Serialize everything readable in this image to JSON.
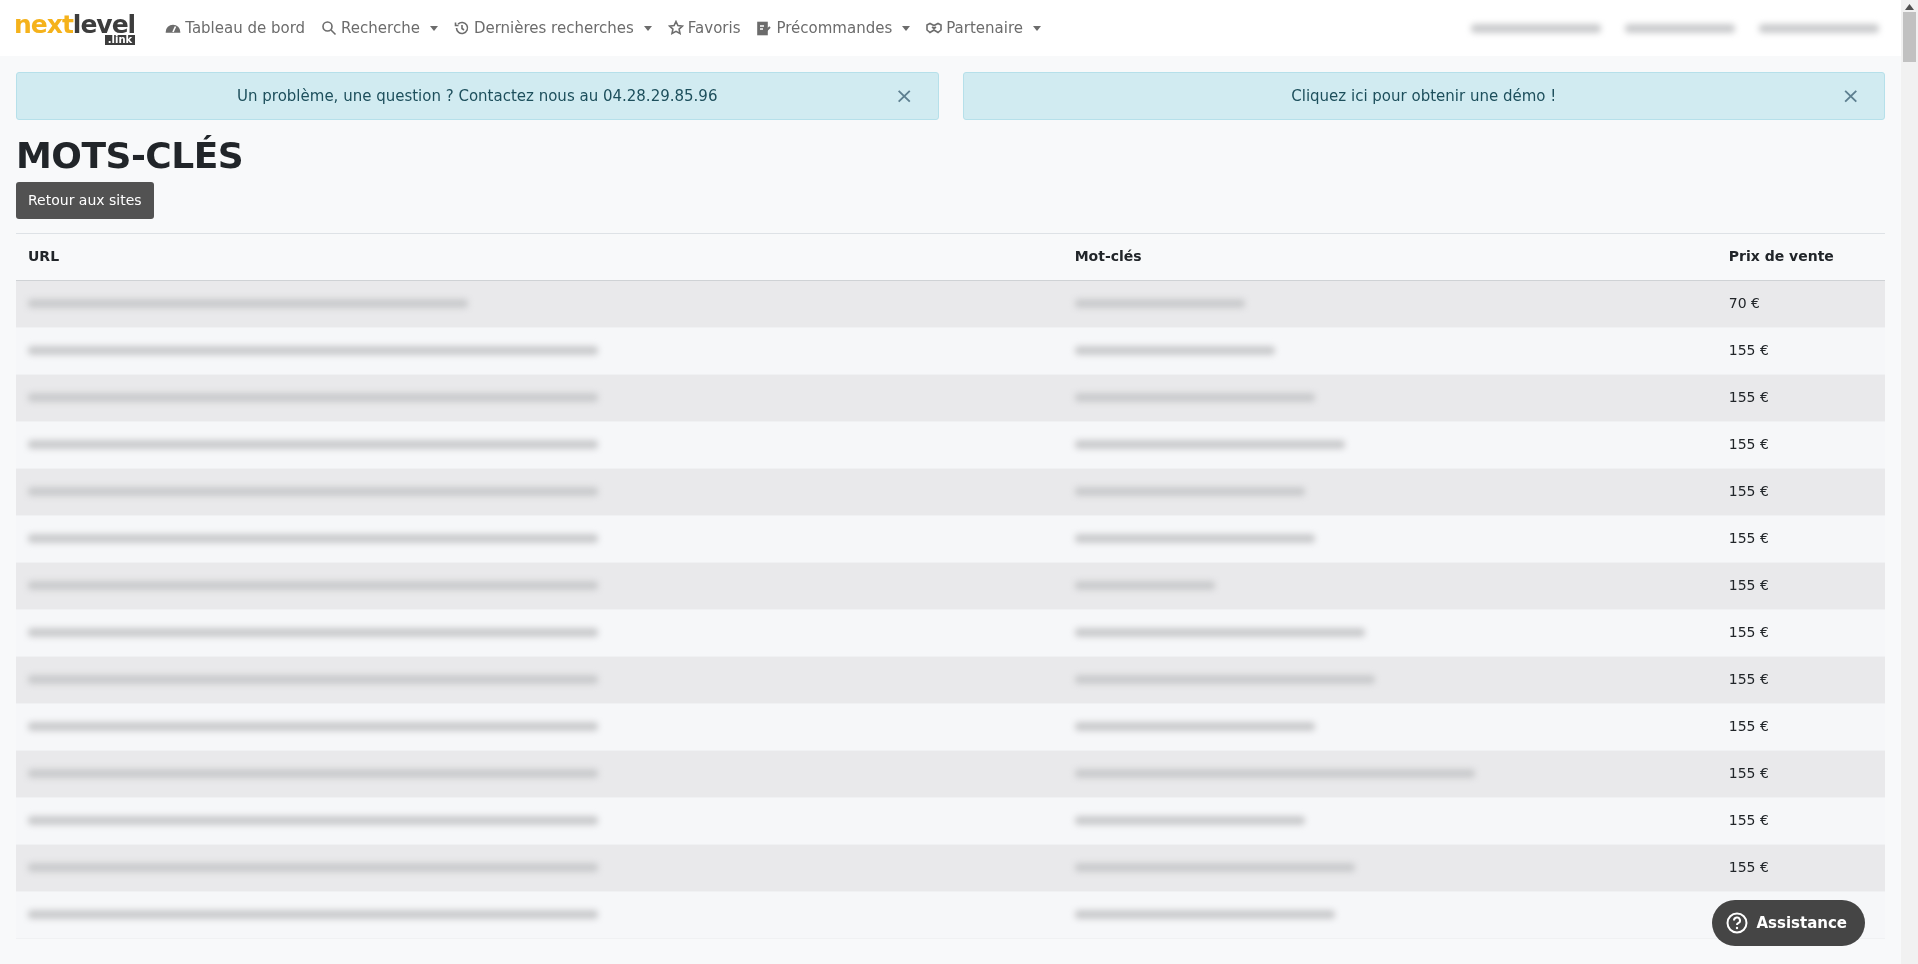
{
  "logo": {
    "part_1": "next",
    "part_2": "level",
    "part_3": ".link"
  },
  "nav": [
    {
      "label": "Tableau de bord",
      "kind": "gauge",
      "dropdown": false
    },
    {
      "label": "Recherche",
      "kind": "search",
      "dropdown": true
    },
    {
      "label": "Dernières recherches",
      "kind": "history",
      "dropdown": true
    },
    {
      "label": "Favoris",
      "kind": "star",
      "dropdown": false
    },
    {
      "label": "Précommandes",
      "kind": "clipboard",
      "dropdown": true
    },
    {
      "label": "Partenaire",
      "kind": "handshake",
      "dropdown": true
    }
  ],
  "alerts": [
    {
      "text": "Un problème, une question ? Contactez nous au 04.28.29.85.96",
      "close": "×"
    },
    {
      "text": "Cliquez ici pour obtenir une démo !",
      "close": "×"
    }
  ],
  "title": "MOTS-CLÉS",
  "back_button": "Retour aux sites",
  "table": {
    "columns": [
      "URL",
      "Mot-clés",
      "Prix de vente"
    ],
    "rows": [
      {
        "price": "70 €"
      },
      {
        "price": "155 €"
      },
      {
        "price": "155 €"
      },
      {
        "price": "155 €"
      },
      {
        "price": "155 €"
      },
      {
        "price": "155 €"
      },
      {
        "price": "155 €"
      },
      {
        "price": "155 €"
      },
      {
        "price": "155 €"
      },
      {
        "price": "155 €"
      },
      {
        "price": "155 €"
      },
      {
        "price": "155 €"
      },
      {
        "price": "155 €"
      },
      {}
    ]
  },
  "assistance_button": "Assistance"
}
